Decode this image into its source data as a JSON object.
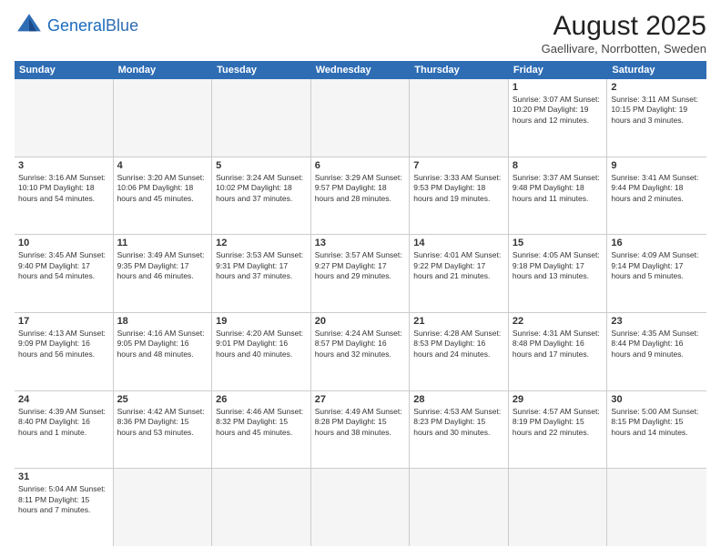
{
  "header": {
    "logo_general": "General",
    "logo_blue": "Blue",
    "main_title": "August 2025",
    "subtitle": "Gaellivare, Norrbotten, Sweden"
  },
  "weekdays": [
    "Sunday",
    "Monday",
    "Tuesday",
    "Wednesday",
    "Thursday",
    "Friday",
    "Saturday"
  ],
  "rows": [
    [
      {
        "day": "",
        "info": "",
        "empty": true
      },
      {
        "day": "",
        "info": "",
        "empty": true
      },
      {
        "day": "",
        "info": "",
        "empty": true
      },
      {
        "day": "",
        "info": "",
        "empty": true
      },
      {
        "day": "",
        "info": "",
        "empty": true
      },
      {
        "day": "1",
        "info": "Sunrise: 3:07 AM\nSunset: 10:20 PM\nDaylight: 19 hours\nand 12 minutes.",
        "empty": false
      },
      {
        "day": "2",
        "info": "Sunrise: 3:11 AM\nSunset: 10:15 PM\nDaylight: 19 hours\nand 3 minutes.",
        "empty": false
      }
    ],
    [
      {
        "day": "3",
        "info": "Sunrise: 3:16 AM\nSunset: 10:10 PM\nDaylight: 18 hours\nand 54 minutes.",
        "empty": false
      },
      {
        "day": "4",
        "info": "Sunrise: 3:20 AM\nSunset: 10:06 PM\nDaylight: 18 hours\nand 45 minutes.",
        "empty": false
      },
      {
        "day": "5",
        "info": "Sunrise: 3:24 AM\nSunset: 10:02 PM\nDaylight: 18 hours\nand 37 minutes.",
        "empty": false
      },
      {
        "day": "6",
        "info": "Sunrise: 3:29 AM\nSunset: 9:57 PM\nDaylight: 18 hours\nand 28 minutes.",
        "empty": false
      },
      {
        "day": "7",
        "info": "Sunrise: 3:33 AM\nSunset: 9:53 PM\nDaylight: 18 hours\nand 19 minutes.",
        "empty": false
      },
      {
        "day": "8",
        "info": "Sunrise: 3:37 AM\nSunset: 9:48 PM\nDaylight: 18 hours\nand 11 minutes.",
        "empty": false
      },
      {
        "day": "9",
        "info": "Sunrise: 3:41 AM\nSunset: 9:44 PM\nDaylight: 18 hours\nand 2 minutes.",
        "empty": false
      }
    ],
    [
      {
        "day": "10",
        "info": "Sunrise: 3:45 AM\nSunset: 9:40 PM\nDaylight: 17 hours\nand 54 minutes.",
        "empty": false
      },
      {
        "day": "11",
        "info": "Sunrise: 3:49 AM\nSunset: 9:35 PM\nDaylight: 17 hours\nand 46 minutes.",
        "empty": false
      },
      {
        "day": "12",
        "info": "Sunrise: 3:53 AM\nSunset: 9:31 PM\nDaylight: 17 hours\nand 37 minutes.",
        "empty": false
      },
      {
        "day": "13",
        "info": "Sunrise: 3:57 AM\nSunset: 9:27 PM\nDaylight: 17 hours\nand 29 minutes.",
        "empty": false
      },
      {
        "day": "14",
        "info": "Sunrise: 4:01 AM\nSunset: 9:22 PM\nDaylight: 17 hours\nand 21 minutes.",
        "empty": false
      },
      {
        "day": "15",
        "info": "Sunrise: 4:05 AM\nSunset: 9:18 PM\nDaylight: 17 hours\nand 13 minutes.",
        "empty": false
      },
      {
        "day": "16",
        "info": "Sunrise: 4:09 AM\nSunset: 9:14 PM\nDaylight: 17 hours\nand 5 minutes.",
        "empty": false
      }
    ],
    [
      {
        "day": "17",
        "info": "Sunrise: 4:13 AM\nSunset: 9:09 PM\nDaylight: 16 hours\nand 56 minutes.",
        "empty": false
      },
      {
        "day": "18",
        "info": "Sunrise: 4:16 AM\nSunset: 9:05 PM\nDaylight: 16 hours\nand 48 minutes.",
        "empty": false
      },
      {
        "day": "19",
        "info": "Sunrise: 4:20 AM\nSunset: 9:01 PM\nDaylight: 16 hours\nand 40 minutes.",
        "empty": false
      },
      {
        "day": "20",
        "info": "Sunrise: 4:24 AM\nSunset: 8:57 PM\nDaylight: 16 hours\nand 32 minutes.",
        "empty": false
      },
      {
        "day": "21",
        "info": "Sunrise: 4:28 AM\nSunset: 8:53 PM\nDaylight: 16 hours\nand 24 minutes.",
        "empty": false
      },
      {
        "day": "22",
        "info": "Sunrise: 4:31 AM\nSunset: 8:48 PM\nDaylight: 16 hours\nand 17 minutes.",
        "empty": false
      },
      {
        "day": "23",
        "info": "Sunrise: 4:35 AM\nSunset: 8:44 PM\nDaylight: 16 hours\nand 9 minutes.",
        "empty": false
      }
    ],
    [
      {
        "day": "24",
        "info": "Sunrise: 4:39 AM\nSunset: 8:40 PM\nDaylight: 16 hours\nand 1 minute.",
        "empty": false
      },
      {
        "day": "25",
        "info": "Sunrise: 4:42 AM\nSunset: 8:36 PM\nDaylight: 15 hours\nand 53 minutes.",
        "empty": false
      },
      {
        "day": "26",
        "info": "Sunrise: 4:46 AM\nSunset: 8:32 PM\nDaylight: 15 hours\nand 45 minutes.",
        "empty": false
      },
      {
        "day": "27",
        "info": "Sunrise: 4:49 AM\nSunset: 8:28 PM\nDaylight: 15 hours\nand 38 minutes.",
        "empty": false
      },
      {
        "day": "28",
        "info": "Sunrise: 4:53 AM\nSunset: 8:23 PM\nDaylight: 15 hours\nand 30 minutes.",
        "empty": false
      },
      {
        "day": "29",
        "info": "Sunrise: 4:57 AM\nSunset: 8:19 PM\nDaylight: 15 hours\nand 22 minutes.",
        "empty": false
      },
      {
        "day": "30",
        "info": "Sunrise: 5:00 AM\nSunset: 8:15 PM\nDaylight: 15 hours\nand 14 minutes.",
        "empty": false
      }
    ],
    [
      {
        "day": "31",
        "info": "Sunrise: 5:04 AM\nSunset: 8:11 PM\nDaylight: 15 hours\nand 7 minutes.",
        "empty": false
      },
      {
        "day": "",
        "info": "",
        "empty": true
      },
      {
        "day": "",
        "info": "",
        "empty": true
      },
      {
        "day": "",
        "info": "",
        "empty": true
      },
      {
        "day": "",
        "info": "",
        "empty": true
      },
      {
        "day": "",
        "info": "",
        "empty": true
      },
      {
        "day": "",
        "info": "",
        "empty": true
      }
    ]
  ]
}
